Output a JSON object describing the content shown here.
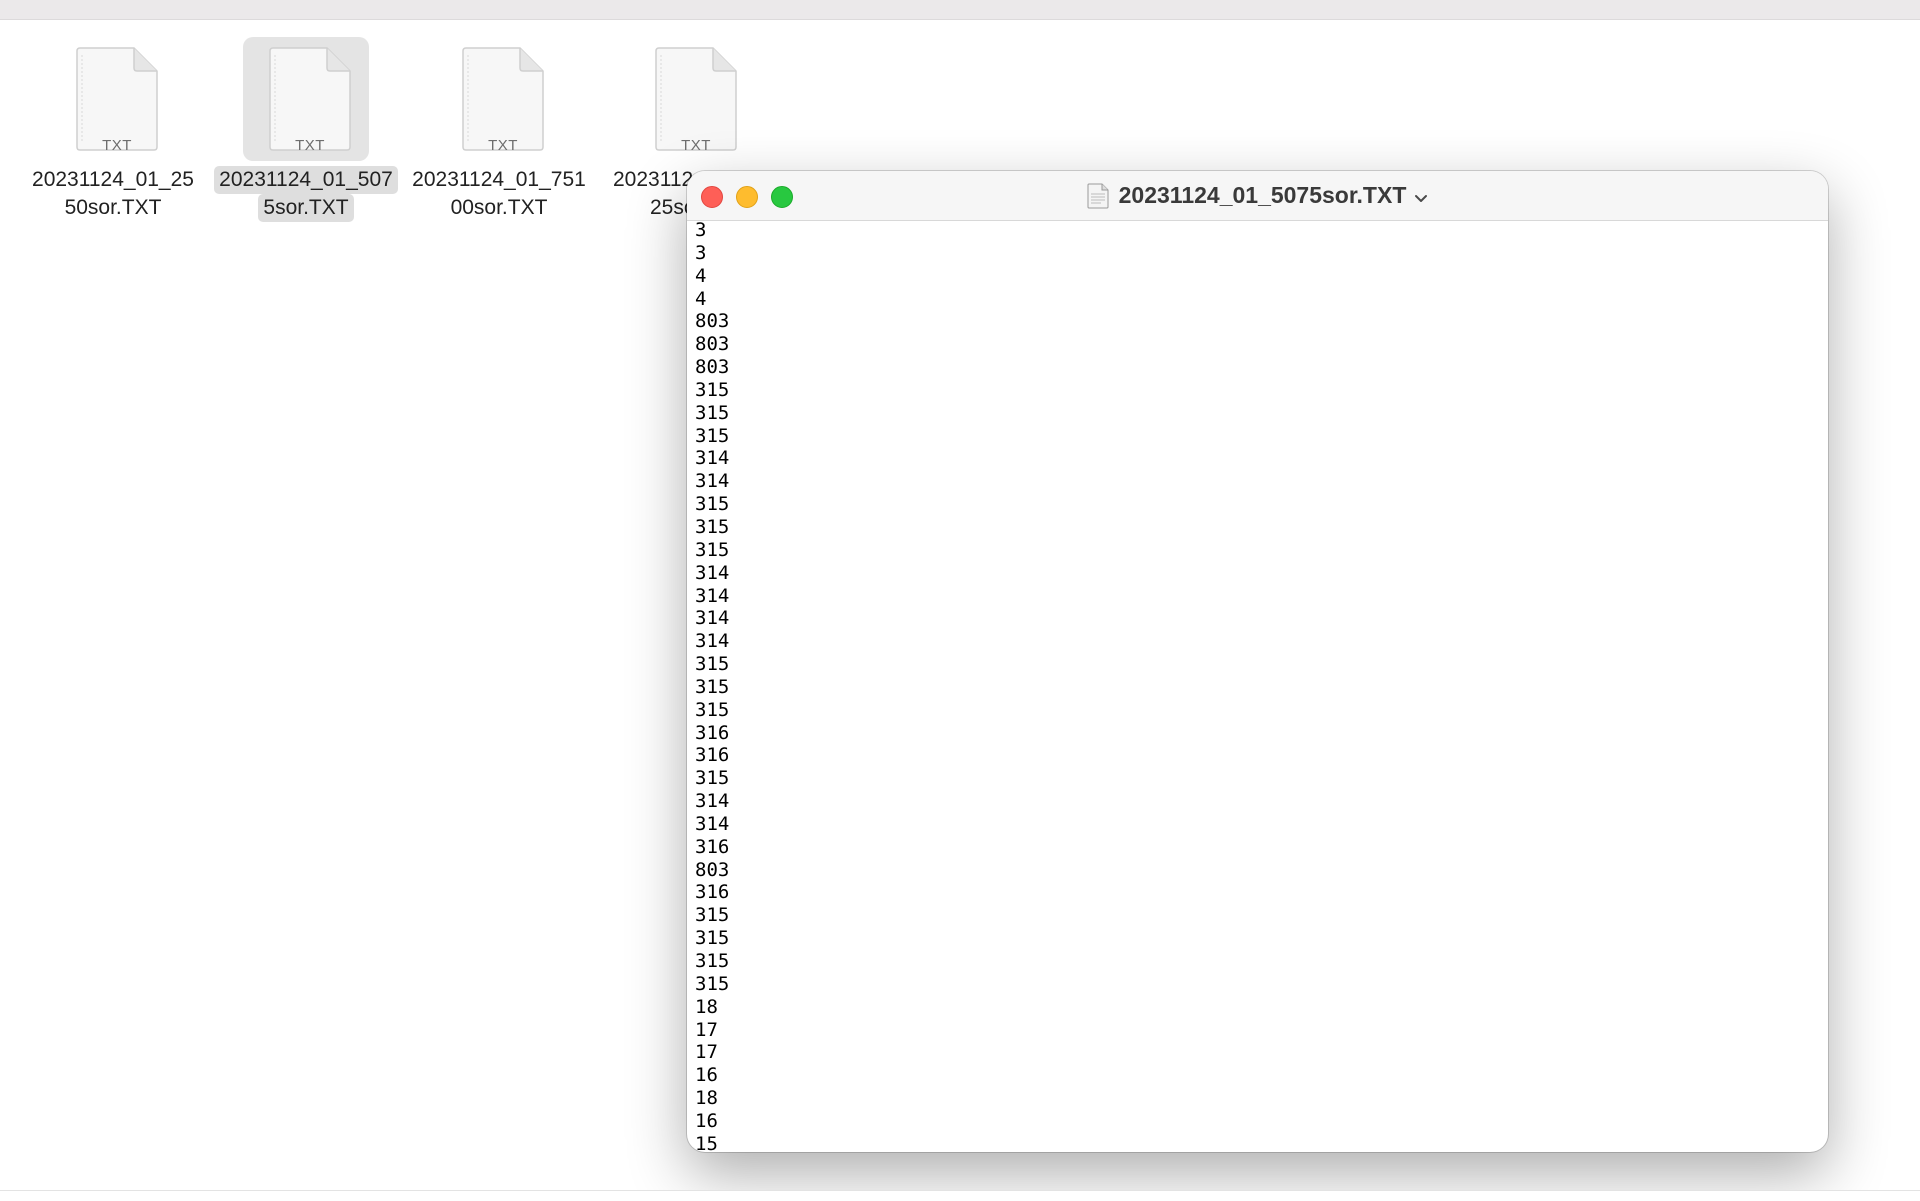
{
  "finder": {
    "items": [
      {
        "ext": "TXT",
        "name_line1": "20231124_01_25",
        "name_line2": "50sor.TXT",
        "selected": false
      },
      {
        "ext": "TXT",
        "name_line1": "20231124_01_507",
        "name_line2": "5sor.TXT",
        "selected": true
      },
      {
        "ext": "TXT",
        "name_line1": "20231124_01_751",
        "name_line2": "00sor.TXT",
        "selected": false
      },
      {
        "ext": "TXT",
        "name_line1": "2023112",
        "name_line2": "25sc",
        "selected": false
      }
    ]
  },
  "window": {
    "title": "20231124_01_5075sor.TXT",
    "lines": [
      "3",
      "3",
      "4",
      "4",
      "803",
      "803",
      "803",
      "315",
      "315",
      "315",
      "314",
      "314",
      "315",
      "315",
      "315",
      "314",
      "314",
      "314",
      "314",
      "315",
      "315",
      "315",
      "316",
      "316",
      "315",
      "314",
      "314",
      "316",
      "803",
      "316",
      "315",
      "315",
      "315",
      "315",
      "18",
      "17",
      "17",
      "16",
      "18",
      "16",
      "15"
    ]
  },
  "colors": {
    "close": "#fe5f57",
    "minimize": "#febc2e",
    "maximize": "#28c840",
    "selection": "#dedede"
  }
}
